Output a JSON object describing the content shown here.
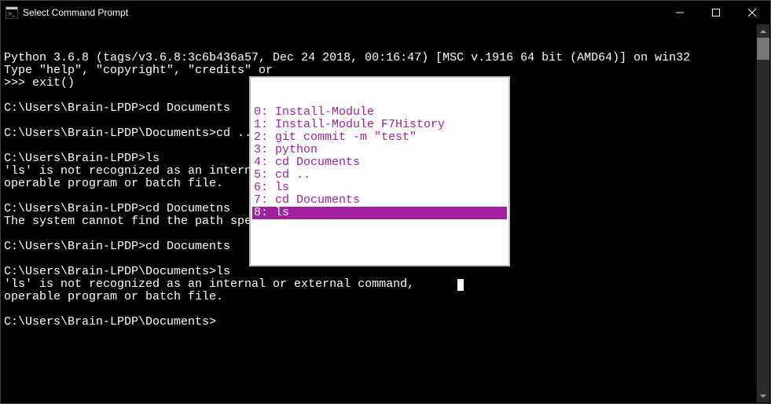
{
  "titlebar": {
    "title": "Select Command Prompt"
  },
  "terminal": {
    "lines": [
      "Python 3.6.8 (tags/v3.6.8:3c6b436a57, Dec 24 2018, 00:16:47) [MSC v.1916 64 bit (AMD64)] on win32",
      "Type \"help\", \"copyright\", \"credits\" or ",
      ">>> exit()",
      "",
      "C:\\Users\\Brain-LPDP>cd Documents",
      "",
      "C:\\Users\\Brain-LPDP\\Documents>cd ..",
      "",
      "C:\\Users\\Brain-LPDP>ls",
      "'ls' is not recognized as an internal o",
      "operable program or batch file.",
      "",
      "C:\\Users\\Brain-LPDP>cd Documetns",
      "The system cannot find the path specified.",
      "",
      "C:\\Users\\Brain-LPDP>cd Documents",
      "",
      "C:\\Users\\Brain-LPDP\\Documents>ls",
      "'ls' is not recognized as an internal or external command,",
      "operable program or batch file.",
      "",
      "C:\\Users\\Brain-LPDP\\Documents>"
    ]
  },
  "history": {
    "items": [
      {
        "idx": "0",
        "cmd": "Install-Module"
      },
      {
        "idx": "1",
        "cmd": "Install-Module F7History"
      },
      {
        "idx": "2",
        "cmd": "git commit -m \"test\""
      },
      {
        "idx": "3",
        "cmd": "python"
      },
      {
        "idx": "4",
        "cmd": "cd Documents"
      },
      {
        "idx": "5",
        "cmd": "cd .."
      },
      {
        "idx": "6",
        "cmd": "ls"
      },
      {
        "idx": "7",
        "cmd": "cd Documents"
      },
      {
        "idx": "8",
        "cmd": "ls"
      }
    ],
    "selectedIndex": 8
  }
}
